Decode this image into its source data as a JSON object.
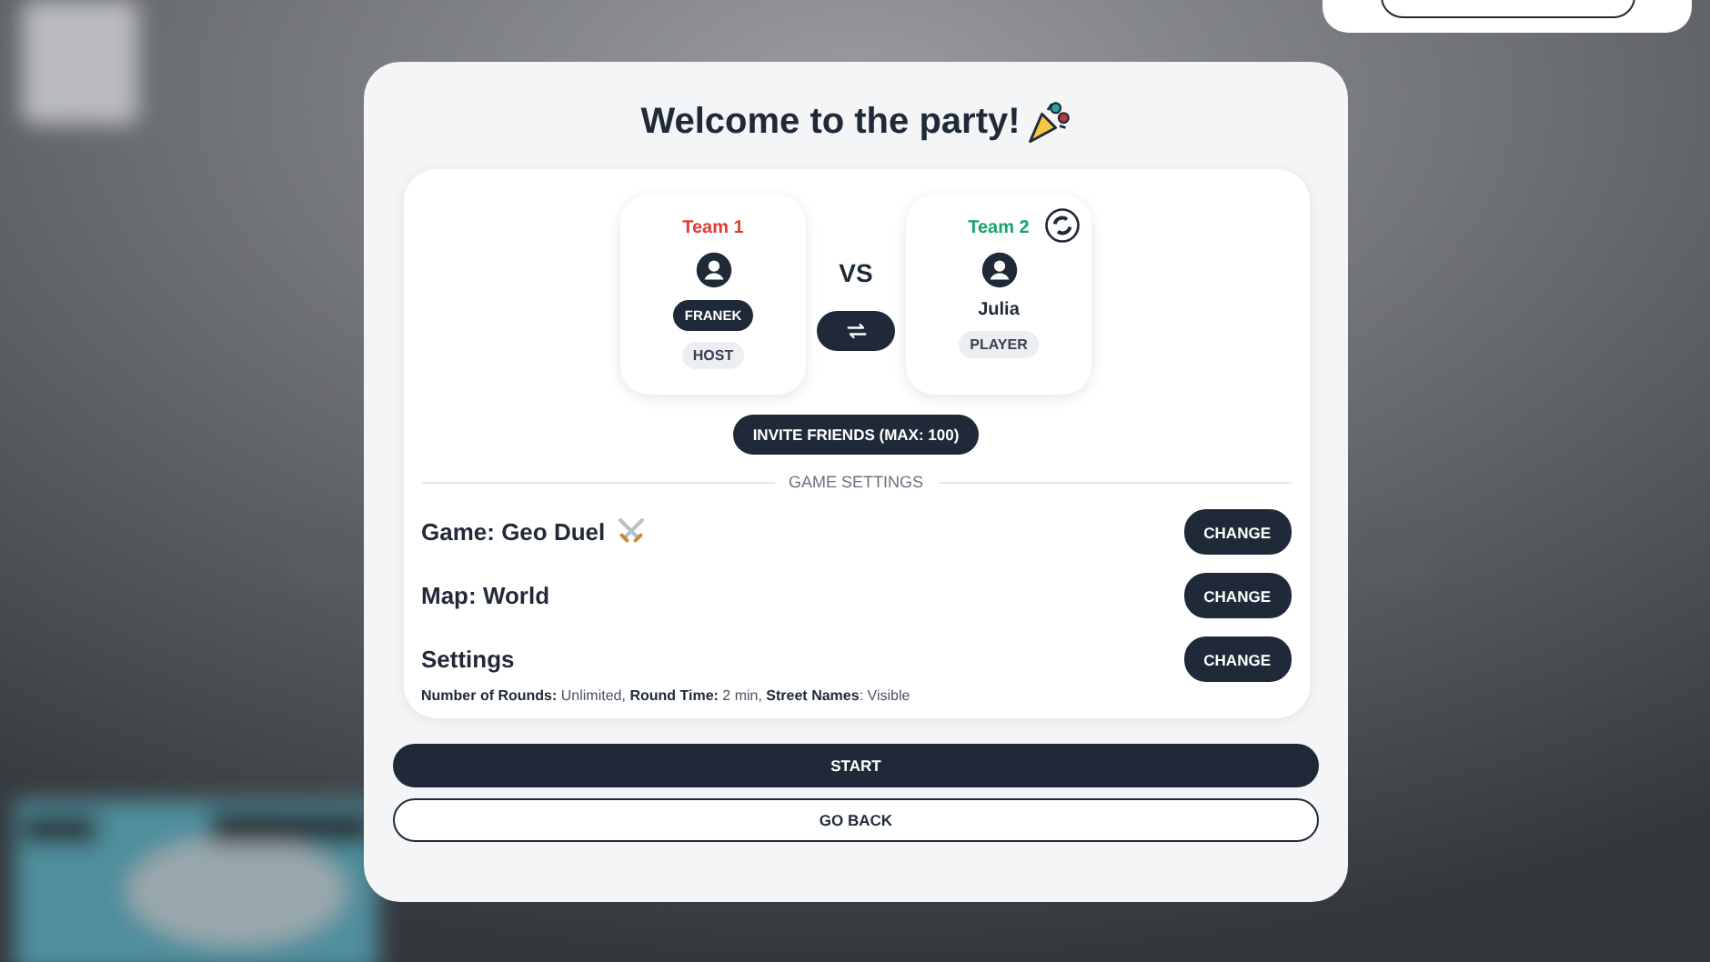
{
  "title": "Welcome to the party!",
  "teams": [
    {
      "label": "Team 1",
      "color": "#e53935",
      "player": "FRANEK",
      "kind": "pill",
      "role": "HOST",
      "corner_icon": false
    },
    {
      "label": "Team 2",
      "color": "#1aa36b",
      "player": "Julia",
      "kind": "plain",
      "role": "PLAYER",
      "corner_icon": true
    }
  ],
  "versus": "VS",
  "invite_button": "INVITE FRIENDS (MAX: 100)",
  "section_heading": "GAME SETTINGS",
  "settings": [
    {
      "kind": "swords",
      "label": "Game: Geo Duel",
      "button": "CHANGE"
    },
    {
      "kind": "plain",
      "label": "Map: World",
      "button": "CHANGE"
    },
    {
      "kind": "plain",
      "label": "Settings",
      "detail": "**Number of Rounds:** Unlimited, **Round Time:** 2 min, **Street Names**: Visible",
      "button": "CHANGE"
    }
  ],
  "start_button": "START",
  "back_button": "GO BACK"
}
